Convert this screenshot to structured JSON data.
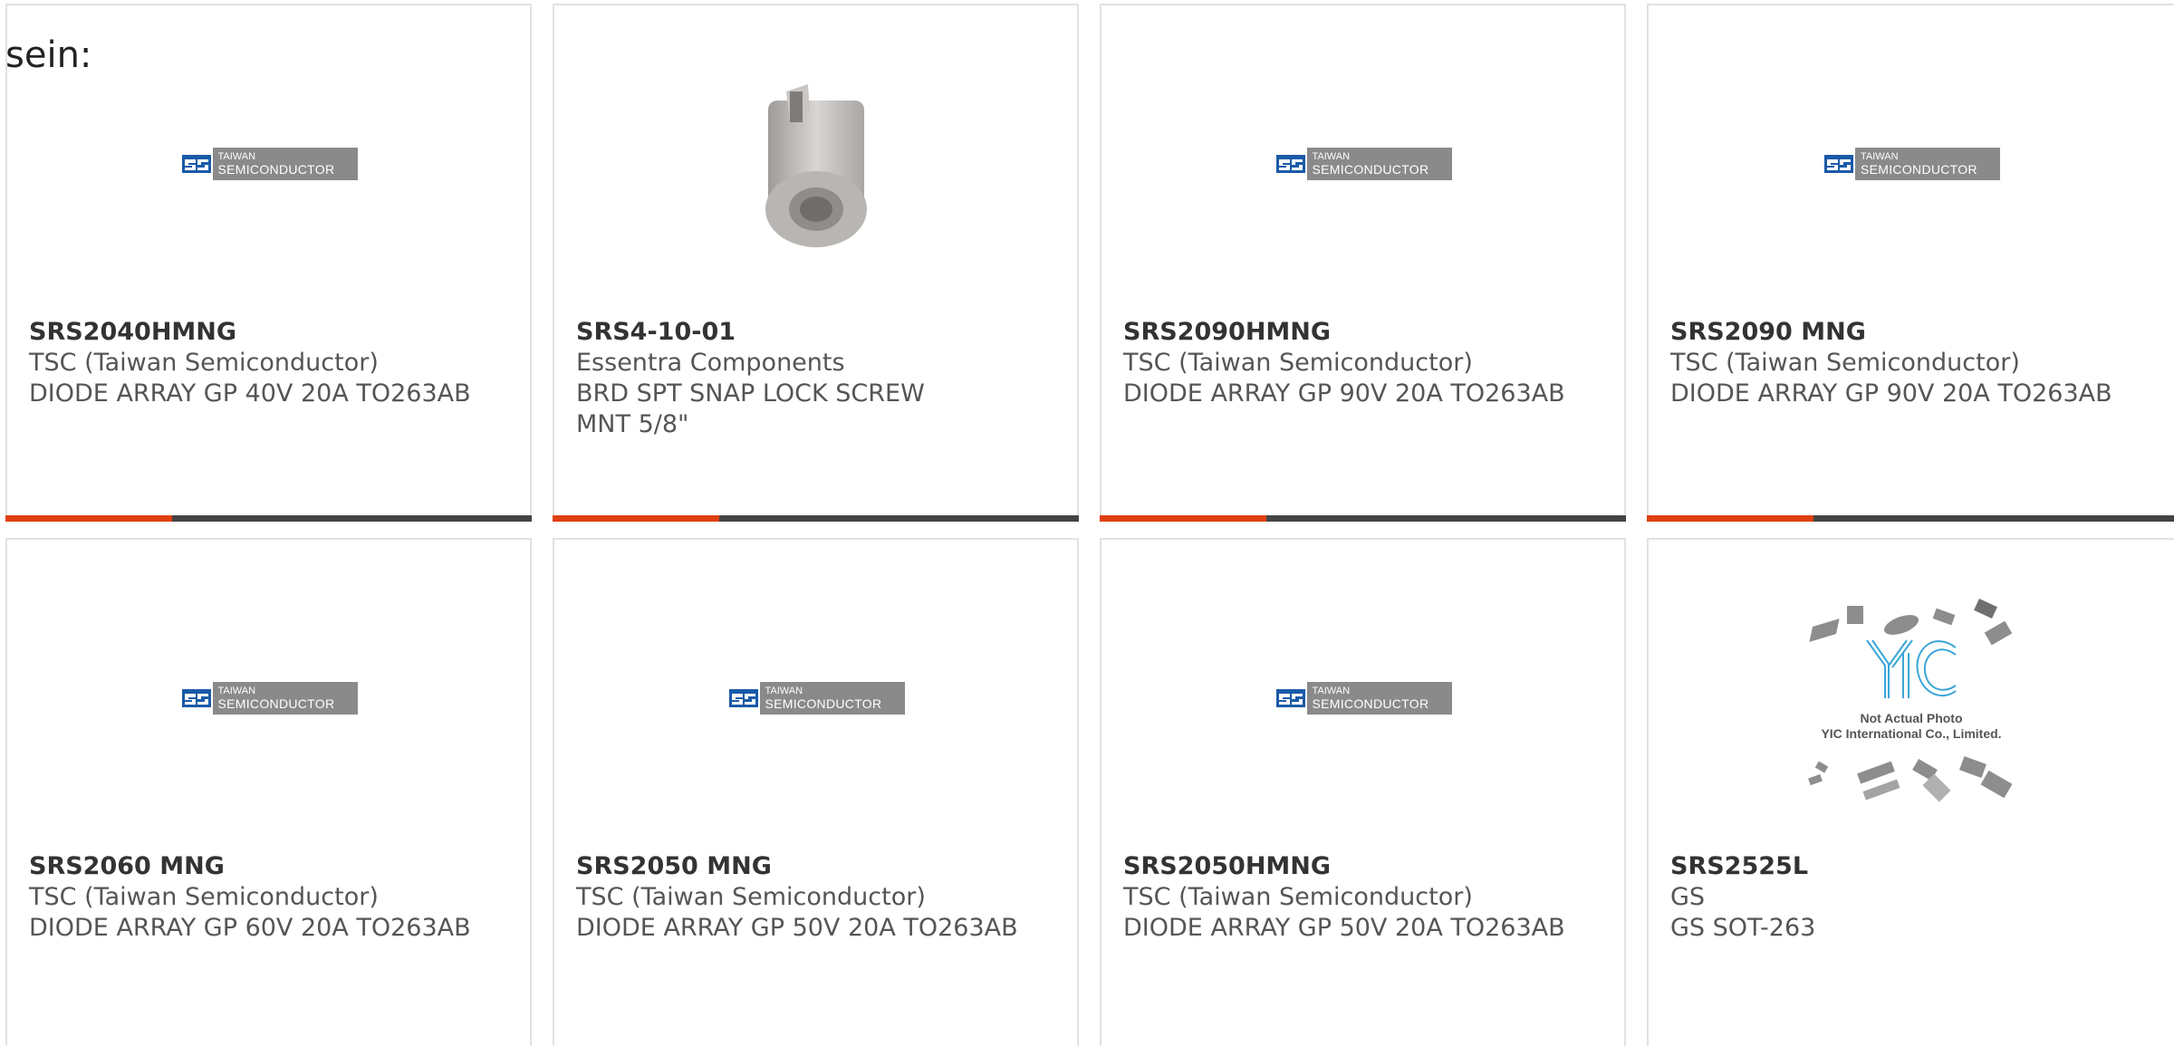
{
  "lead_text": "sein:",
  "colors": {
    "accent_bar": "#e04010",
    "bar": "#444444",
    "card_border": "#e2e2e2"
  },
  "products": [
    {
      "part_number": "SRS2040HMNG",
      "manufacturer": "TSC (Taiwan Semiconductor)",
      "description": "DIODE ARRAY GP 40V 20A TO263AB",
      "image": "tsc-logo"
    },
    {
      "part_number": "SRS4-10-01",
      "manufacturer": "Essentra Components",
      "description": "BRD SPT SNAP LOCK SCREW MNT 5/8\"",
      "image": "snap-lock-screw-photo"
    },
    {
      "part_number": "SRS2090HMNG",
      "manufacturer": "TSC (Taiwan Semiconductor)",
      "description": "DIODE ARRAY GP 90V 20A TO263AB",
      "image": "tsc-logo"
    },
    {
      "part_number": "SRS2090 MNG",
      "manufacturer": "TSC (Taiwan Semiconductor)",
      "description": "DIODE ARRAY GP 90V 20A TO263AB",
      "image": "tsc-logo"
    },
    {
      "part_number": "SRS2060 MNG",
      "manufacturer": "TSC (Taiwan Semiconductor)",
      "description": "DIODE ARRAY GP 60V 20A TO263AB",
      "image": "tsc-logo"
    },
    {
      "part_number": "SRS2050 MNG",
      "manufacturer": "TSC (Taiwan Semiconductor)",
      "description": "DIODE ARRAY GP 50V 20A TO263AB",
      "image": "tsc-logo"
    },
    {
      "part_number": "SRS2050HMNG",
      "manufacturer": "TSC (Taiwan Semiconductor)",
      "description": "DIODE ARRAY GP 50V 20A TO263AB",
      "image": "tsc-logo"
    },
    {
      "part_number": "SRS2525L",
      "manufacturer": "GS",
      "description": "GS SOT-263",
      "image": "yic-not-actual-photo"
    }
  ],
  "tsc_logo": {
    "line1": "TAIWAN",
    "line2": "SEMICONDUCTOR"
  },
  "yic_placeholder": {
    "line1": "Not Actual Photo",
    "line2": "YIC International Co., Limited."
  }
}
